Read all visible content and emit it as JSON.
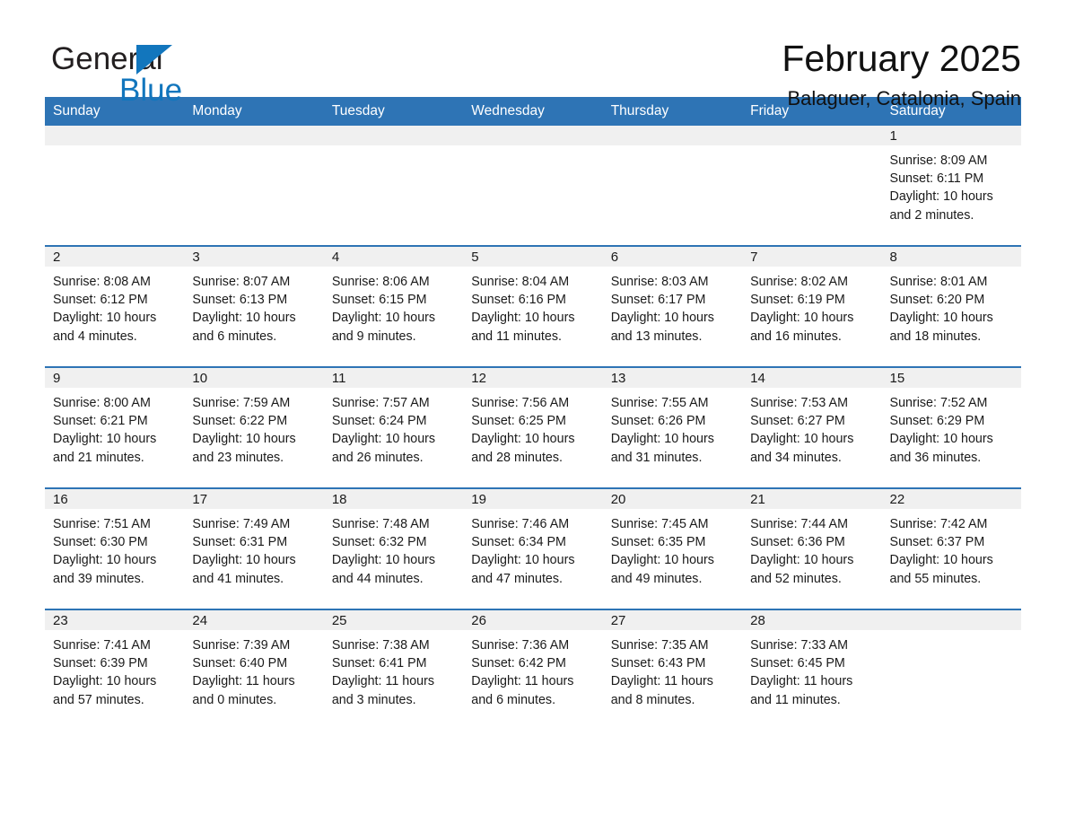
{
  "brand": {
    "word1": "General",
    "word2": "Blue",
    "flag_icon": "triangle-flag-icon",
    "color_blue": "#1276bd",
    "color_dark": "#231f20"
  },
  "header": {
    "title": "February 2025",
    "location": "Balaguer, Catalonia, Spain"
  },
  "theme": {
    "header_blue": "#2e74b5",
    "daynum_band": "#f0f0f0",
    "separator": "#2e74b5"
  },
  "calendar": {
    "weekday_headers": [
      "Sunday",
      "Monday",
      "Tuesday",
      "Wednesday",
      "Thursday",
      "Friday",
      "Saturday"
    ],
    "weeks": [
      [
        {
          "day": "",
          "empty": true
        },
        {
          "day": "",
          "empty": true
        },
        {
          "day": "",
          "empty": true
        },
        {
          "day": "",
          "empty": true
        },
        {
          "day": "",
          "empty": true
        },
        {
          "day": "",
          "empty": true
        },
        {
          "day": "1",
          "sunrise": "Sunrise: 8:09 AM",
          "sunset": "Sunset: 6:11 PM",
          "daylight": "Daylight: 10 hours and 2 minutes."
        }
      ],
      [
        {
          "day": "2",
          "sunrise": "Sunrise: 8:08 AM",
          "sunset": "Sunset: 6:12 PM",
          "daylight": "Daylight: 10 hours and 4 minutes."
        },
        {
          "day": "3",
          "sunrise": "Sunrise: 8:07 AM",
          "sunset": "Sunset: 6:13 PM",
          "daylight": "Daylight: 10 hours and 6 minutes."
        },
        {
          "day": "4",
          "sunrise": "Sunrise: 8:06 AM",
          "sunset": "Sunset: 6:15 PM",
          "daylight": "Daylight: 10 hours and 9 minutes."
        },
        {
          "day": "5",
          "sunrise": "Sunrise: 8:04 AM",
          "sunset": "Sunset: 6:16 PM",
          "daylight": "Daylight: 10 hours and 11 minutes."
        },
        {
          "day": "6",
          "sunrise": "Sunrise: 8:03 AM",
          "sunset": "Sunset: 6:17 PM",
          "daylight": "Daylight: 10 hours and 13 minutes."
        },
        {
          "day": "7",
          "sunrise": "Sunrise: 8:02 AM",
          "sunset": "Sunset: 6:19 PM",
          "daylight": "Daylight: 10 hours and 16 minutes."
        },
        {
          "day": "8",
          "sunrise": "Sunrise: 8:01 AM",
          "sunset": "Sunset: 6:20 PM",
          "daylight": "Daylight: 10 hours and 18 minutes."
        }
      ],
      [
        {
          "day": "9",
          "sunrise": "Sunrise: 8:00 AM",
          "sunset": "Sunset: 6:21 PM",
          "daylight": "Daylight: 10 hours and 21 minutes."
        },
        {
          "day": "10",
          "sunrise": "Sunrise: 7:59 AM",
          "sunset": "Sunset: 6:22 PM",
          "daylight": "Daylight: 10 hours and 23 minutes."
        },
        {
          "day": "11",
          "sunrise": "Sunrise: 7:57 AM",
          "sunset": "Sunset: 6:24 PM",
          "daylight": "Daylight: 10 hours and 26 minutes."
        },
        {
          "day": "12",
          "sunrise": "Sunrise: 7:56 AM",
          "sunset": "Sunset: 6:25 PM",
          "daylight": "Daylight: 10 hours and 28 minutes."
        },
        {
          "day": "13",
          "sunrise": "Sunrise: 7:55 AM",
          "sunset": "Sunset: 6:26 PM",
          "daylight": "Daylight: 10 hours and 31 minutes."
        },
        {
          "day": "14",
          "sunrise": "Sunrise: 7:53 AM",
          "sunset": "Sunset: 6:27 PM",
          "daylight": "Daylight: 10 hours and 34 minutes."
        },
        {
          "day": "15",
          "sunrise": "Sunrise: 7:52 AM",
          "sunset": "Sunset: 6:29 PM",
          "daylight": "Daylight: 10 hours and 36 minutes."
        }
      ],
      [
        {
          "day": "16",
          "sunrise": "Sunrise: 7:51 AM",
          "sunset": "Sunset: 6:30 PM",
          "daylight": "Daylight: 10 hours and 39 minutes."
        },
        {
          "day": "17",
          "sunrise": "Sunrise: 7:49 AM",
          "sunset": "Sunset: 6:31 PM",
          "daylight": "Daylight: 10 hours and 41 minutes."
        },
        {
          "day": "18",
          "sunrise": "Sunrise: 7:48 AM",
          "sunset": "Sunset: 6:32 PM",
          "daylight": "Daylight: 10 hours and 44 minutes."
        },
        {
          "day": "19",
          "sunrise": "Sunrise: 7:46 AM",
          "sunset": "Sunset: 6:34 PM",
          "daylight": "Daylight: 10 hours and 47 minutes."
        },
        {
          "day": "20",
          "sunrise": "Sunrise: 7:45 AM",
          "sunset": "Sunset: 6:35 PM",
          "daylight": "Daylight: 10 hours and 49 minutes."
        },
        {
          "day": "21",
          "sunrise": "Sunrise: 7:44 AM",
          "sunset": "Sunset: 6:36 PM",
          "daylight": "Daylight: 10 hours and 52 minutes."
        },
        {
          "day": "22",
          "sunrise": "Sunrise: 7:42 AM",
          "sunset": "Sunset: 6:37 PM",
          "daylight": "Daylight: 10 hours and 55 minutes."
        }
      ],
      [
        {
          "day": "23",
          "sunrise": "Sunrise: 7:41 AM",
          "sunset": "Sunset: 6:39 PM",
          "daylight": "Daylight: 10 hours and 57 minutes."
        },
        {
          "day": "24",
          "sunrise": "Sunrise: 7:39 AM",
          "sunset": "Sunset: 6:40 PM",
          "daylight": "Daylight: 11 hours and 0 minutes."
        },
        {
          "day": "25",
          "sunrise": "Sunrise: 7:38 AM",
          "sunset": "Sunset: 6:41 PM",
          "daylight": "Daylight: 11 hours and 3 minutes."
        },
        {
          "day": "26",
          "sunrise": "Sunrise: 7:36 AM",
          "sunset": "Sunset: 6:42 PM",
          "daylight": "Daylight: 11 hours and 6 minutes."
        },
        {
          "day": "27",
          "sunrise": "Sunrise: 7:35 AM",
          "sunset": "Sunset: 6:43 PM",
          "daylight": "Daylight: 11 hours and 8 minutes."
        },
        {
          "day": "28",
          "sunrise": "Sunrise: 7:33 AM",
          "sunset": "Sunset: 6:45 PM",
          "daylight": "Daylight: 11 hours and 11 minutes."
        },
        {
          "day": "",
          "empty": true
        }
      ]
    ]
  }
}
